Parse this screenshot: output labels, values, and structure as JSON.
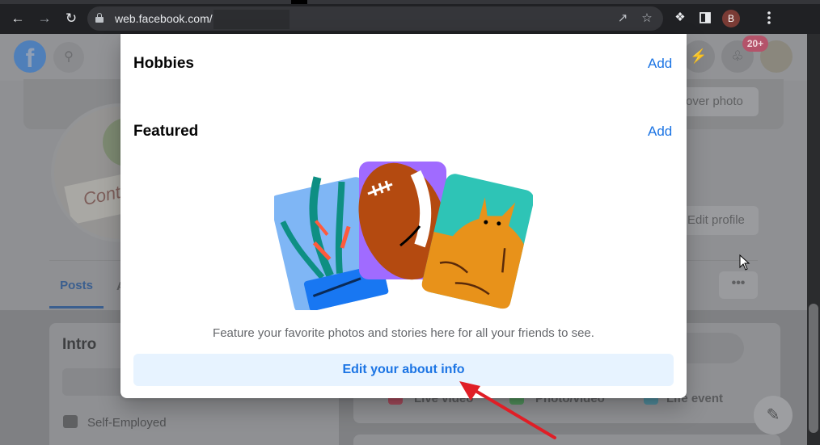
{
  "browser": {
    "url": "web.facebook.com/",
    "profile_initial": "B"
  },
  "page": {
    "cover_button": "over photo",
    "notifications_badge": "20+",
    "profile_signage": "Conti",
    "edit_profile_button": "Edit profile",
    "tabs": [
      {
        "label": "Posts"
      },
      {
        "label": "A"
      }
    ],
    "more_button": "•••",
    "intro": {
      "title": "Intro",
      "job": "Self-Employed"
    },
    "create_post_options": [
      {
        "label": "Live video",
        "color": "#a44a5a"
      },
      {
        "label": "Photo/video",
        "color": "#4f8f5a"
      },
      {
        "label": "Life event",
        "color": "#4f8a9a"
      }
    ]
  },
  "modal": {
    "hobbies": {
      "title": "Hobbies",
      "add_label": "Add"
    },
    "featured": {
      "title": "Featured",
      "add_label": "Add"
    },
    "feature_text": "Feature your favorite photos and stories here for all your friends to see.",
    "edit_about_button": "Edit your about info"
  },
  "colors": {
    "facebook_blue": "#1b74e4",
    "button_bg": "#e7f3ff",
    "annotation_arrow": "#e01e26"
  }
}
